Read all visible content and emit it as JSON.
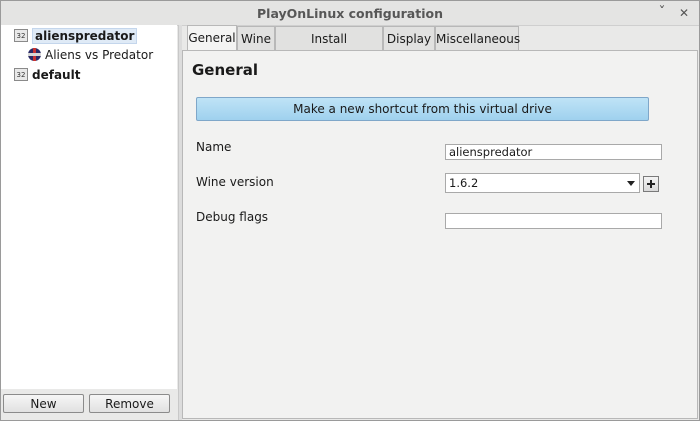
{
  "window": {
    "title": "PlayOnLinux configuration",
    "minimize_glyph": "ˇ",
    "close_glyph": "✕"
  },
  "tree": {
    "items": [
      {
        "label": "alienspredator",
        "icon": "32bit-prefix-icon",
        "badge": "32",
        "selected": true
      },
      {
        "label": "Aliens vs Predator",
        "icon": "game-icon"
      },
      {
        "label": "default",
        "icon": "32bit-prefix-icon",
        "badge": "32"
      }
    ],
    "new_label": "New",
    "remove_label": "Remove"
  },
  "tabs": [
    "General",
    "Wine",
    "Install components",
    "Display",
    "Miscellaneous"
  ],
  "active_tab": "General",
  "general": {
    "heading": "General",
    "shortcut_button": "Make a new shortcut from this virtual drive",
    "name_label": "Name",
    "name_value": "alienspredator",
    "wine_label": "Wine version",
    "wine_value": "1.6.2",
    "debug_label": "Debug flags",
    "debug_value": ""
  },
  "colors": {
    "accent": "#a8d8f0",
    "selection": "#dfeaf6"
  }
}
